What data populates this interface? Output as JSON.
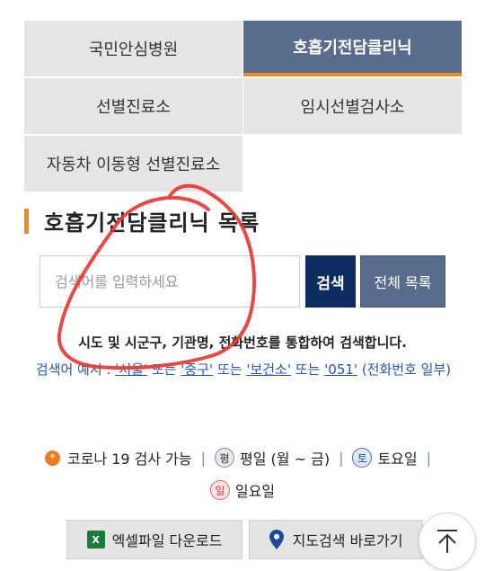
{
  "tabs": [
    {
      "label": "국민안심병원",
      "active": false
    },
    {
      "label": "호흡기전담클리닉",
      "active": true
    },
    {
      "label": "선별진료소",
      "active": false
    },
    {
      "label": "임시선별검사소",
      "active": false
    },
    {
      "label": "자동차 이동형 선별진료소",
      "active": false
    }
  ],
  "section": {
    "title": "호흡기전담클리닉 목록"
  },
  "search": {
    "placeholder": "검색어를 입력하세요",
    "search_button": "검색",
    "all_button": "전체 목록"
  },
  "guide": {
    "main": "시도 및 시군구, 기관명, 전화번호를 통합하여 검색합니다.",
    "example_prefix": "검색어 예시 :",
    "kw1": "'서울'",
    "or1": "또는",
    "kw2": "'중구'",
    "or2": "또는",
    "kw3": "'보건소'",
    "or3": "또는",
    "kw4": "'051'",
    "suffix": "(전화번호 일부)"
  },
  "legend": {
    "covid": {
      "glyph": "*",
      "label": "코로나 19 검사 가능"
    },
    "weekday": {
      "glyph": "평",
      "label": "평일 (월 ~ 금)"
    },
    "saturday": {
      "glyph": "토",
      "label": "토요일"
    },
    "sunday": {
      "glyph": "일",
      "label": "일요일"
    },
    "separator": "|"
  },
  "buttons": {
    "excel": {
      "icon_text": "X",
      "label": "엑셀파일 다운로드"
    },
    "map": {
      "label": "지도검색 바로가기"
    }
  },
  "icons": {
    "excel": "excel-icon",
    "map": "map-pin-icon",
    "top": "arrow-up-icon"
  },
  "colors": {
    "active_tab": "#5a6c8d",
    "accent_orange": "#f08a1c",
    "search_button": "#0d2c5f",
    "link_blue": "#2a55a8",
    "annotation_red": "#e53935"
  }
}
